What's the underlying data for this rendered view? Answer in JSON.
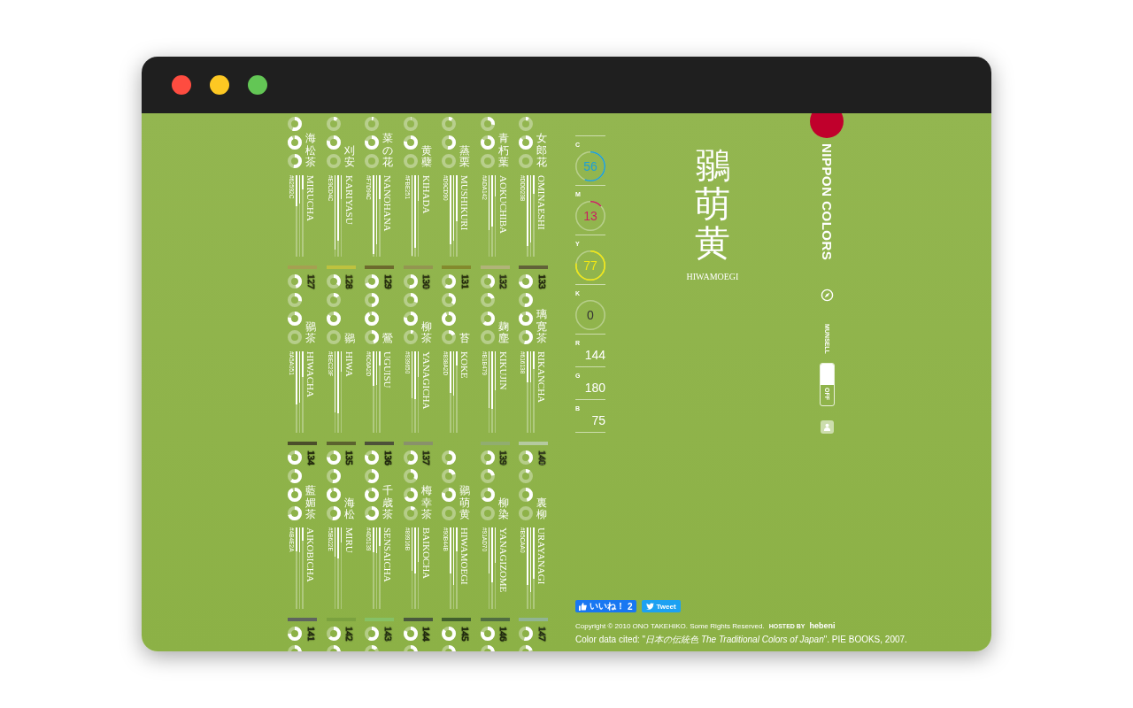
{
  "window": {
    "controls": [
      {
        "color": "#fe4c40"
      },
      {
        "color": "#fdc823"
      },
      {
        "color": "#63c655"
      }
    ]
  },
  "grid": {
    "rows": [
      {
        "cards": [
          {
            "kanji": "海松茶",
            "hex": "#62592C",
            "romaji": "MIRUCHA"
          },
          {
            "kanji": "刈安",
            "hex": "#E9CD4C",
            "romaji": "KARIYASU"
          },
          {
            "kanji": "菜の花",
            "hex": "#F7D94C",
            "romaji": "NANOHANA"
          },
          {
            "kanji": "黄蘗",
            "hex": "#FBE251",
            "romaji": "KIHADA"
          },
          {
            "kanji": "蒸栗",
            "hex": "#D9CD90",
            "romaji": "MUSHIKURI"
          },
          {
            "kanji": "青朽葉",
            "hex": "#ADA142",
            "romaji": "AOKUCHIBA"
          },
          {
            "kanji": "女郎花",
            "hex": "#DDD23B",
            "romaji": "OMINAESHI"
          }
        ]
      },
      {
        "cards": [
          {
            "number": "127",
            "color": "#a5a051",
            "kanji": "鶸茶",
            "hex": "#A5A051",
            "romaji": "HIWACHA"
          },
          {
            "number": "128",
            "color": "#bec23f",
            "kanji": "鶸",
            "hex": "#BEC23F",
            "romaji": "HIWA"
          },
          {
            "number": "129",
            "color": "#6c6a2d",
            "kanji": "鶯",
            "hex": "#6C6A2D",
            "romaji": "UGUISU"
          },
          {
            "number": "130",
            "color": "#939650",
            "kanji": "柳茶",
            "hex": "#939650",
            "romaji": "YANAGICHA"
          },
          {
            "number": "131",
            "color": "#838a2d",
            "kanji": "苔",
            "hex": "#838A2D",
            "romaji": "KOKE"
          },
          {
            "number": "132",
            "color": "#b1b479",
            "kanji": "麹塵",
            "hex": "#B1B479",
            "romaji": "KIKUJIN"
          },
          {
            "number": "133",
            "color": "#616138",
            "kanji": "璃寛茶",
            "hex": "#616138",
            "romaji": "RIKANCHA"
          }
        ]
      },
      {
        "cards": [
          {
            "number": "134",
            "color": "#4b4e2a",
            "kanji": "藍媚茶",
            "hex": "#4B4E2A",
            "romaji": "AIKOBICHA"
          },
          {
            "number": "135",
            "color": "#5b622e",
            "kanji": "海松",
            "hex": "#5B622E",
            "romaji": "MIRU"
          },
          {
            "number": "136",
            "color": "#4d5139",
            "kanji": "千歳茶",
            "hex": "#4D5139",
            "romaji": "SENSAICHA"
          },
          {
            "number": "137",
            "color": "#89916b",
            "kanji": "梅幸茶",
            "hex": "#89916B",
            "romaji": "BAIKOCHA"
          },
          {
            "kanji": "鶸萌黄",
            "hex": "#90B44B",
            "romaji": "HIWAMOEGI"
          },
          {
            "number": "139",
            "color": "#91ad70",
            "kanji": "柳染",
            "hex": "#91AD70",
            "romaji": "YANAGIZOME"
          },
          {
            "number": "140",
            "color": "#b5caa0",
            "kanji": "裏柳",
            "hex": "#B5CAA0",
            "romaji": "URAYANAGI"
          }
        ]
      },
      {
        "cards": [
          {
            "number": "141",
            "color": "#5f655e"
          },
          {
            "number": "142",
            "color": "#7ba23f"
          },
          {
            "number": "143",
            "color": "#86c166"
          },
          {
            "number": "144",
            "color": "#4a593d"
          },
          {
            "number": "145",
            "color": "#42602d"
          },
          {
            "number": "146",
            "color": "#516e41"
          },
          {
            "number": "147",
            "color": "#91b493"
          }
        ]
      }
    ]
  },
  "cmyk": [
    {
      "label": "C",
      "value": "56",
      "color": "#1e9fd6"
    },
    {
      "label": "M",
      "value": "13",
      "color": "#c8235e"
    },
    {
      "label": "Y",
      "value": "77",
      "color": "#f3e812"
    },
    {
      "label": "K",
      "value": "0",
      "color": "#333333"
    }
  ],
  "rgb": [
    {
      "label": "R",
      "value": "144"
    },
    {
      "label": "G",
      "value": "180"
    },
    {
      "label": "B",
      "value": "75"
    }
  ],
  "name": {
    "kanji": "鶸萌黄",
    "romaji": "HIWAMOEGI"
  },
  "sidebar": {
    "logo": "NIPPON COLORS",
    "munsell": {
      "label": "MUNSELL",
      "state": "OFF",
      "on": false
    }
  },
  "footer": {
    "like": {
      "label": "いいね！",
      "count": "2"
    },
    "tweet": "Tweet",
    "copyright": "Copyright © 2010 ONO TAKEHIKO. Some Rights Reserved.",
    "hosted_by": "HOSTED BY",
    "host": "hebeni",
    "cited": "Color data cited: \"*日本の伝統色 The Traditional Colors of Japan*\". PIE BOOKS, 2007."
  }
}
